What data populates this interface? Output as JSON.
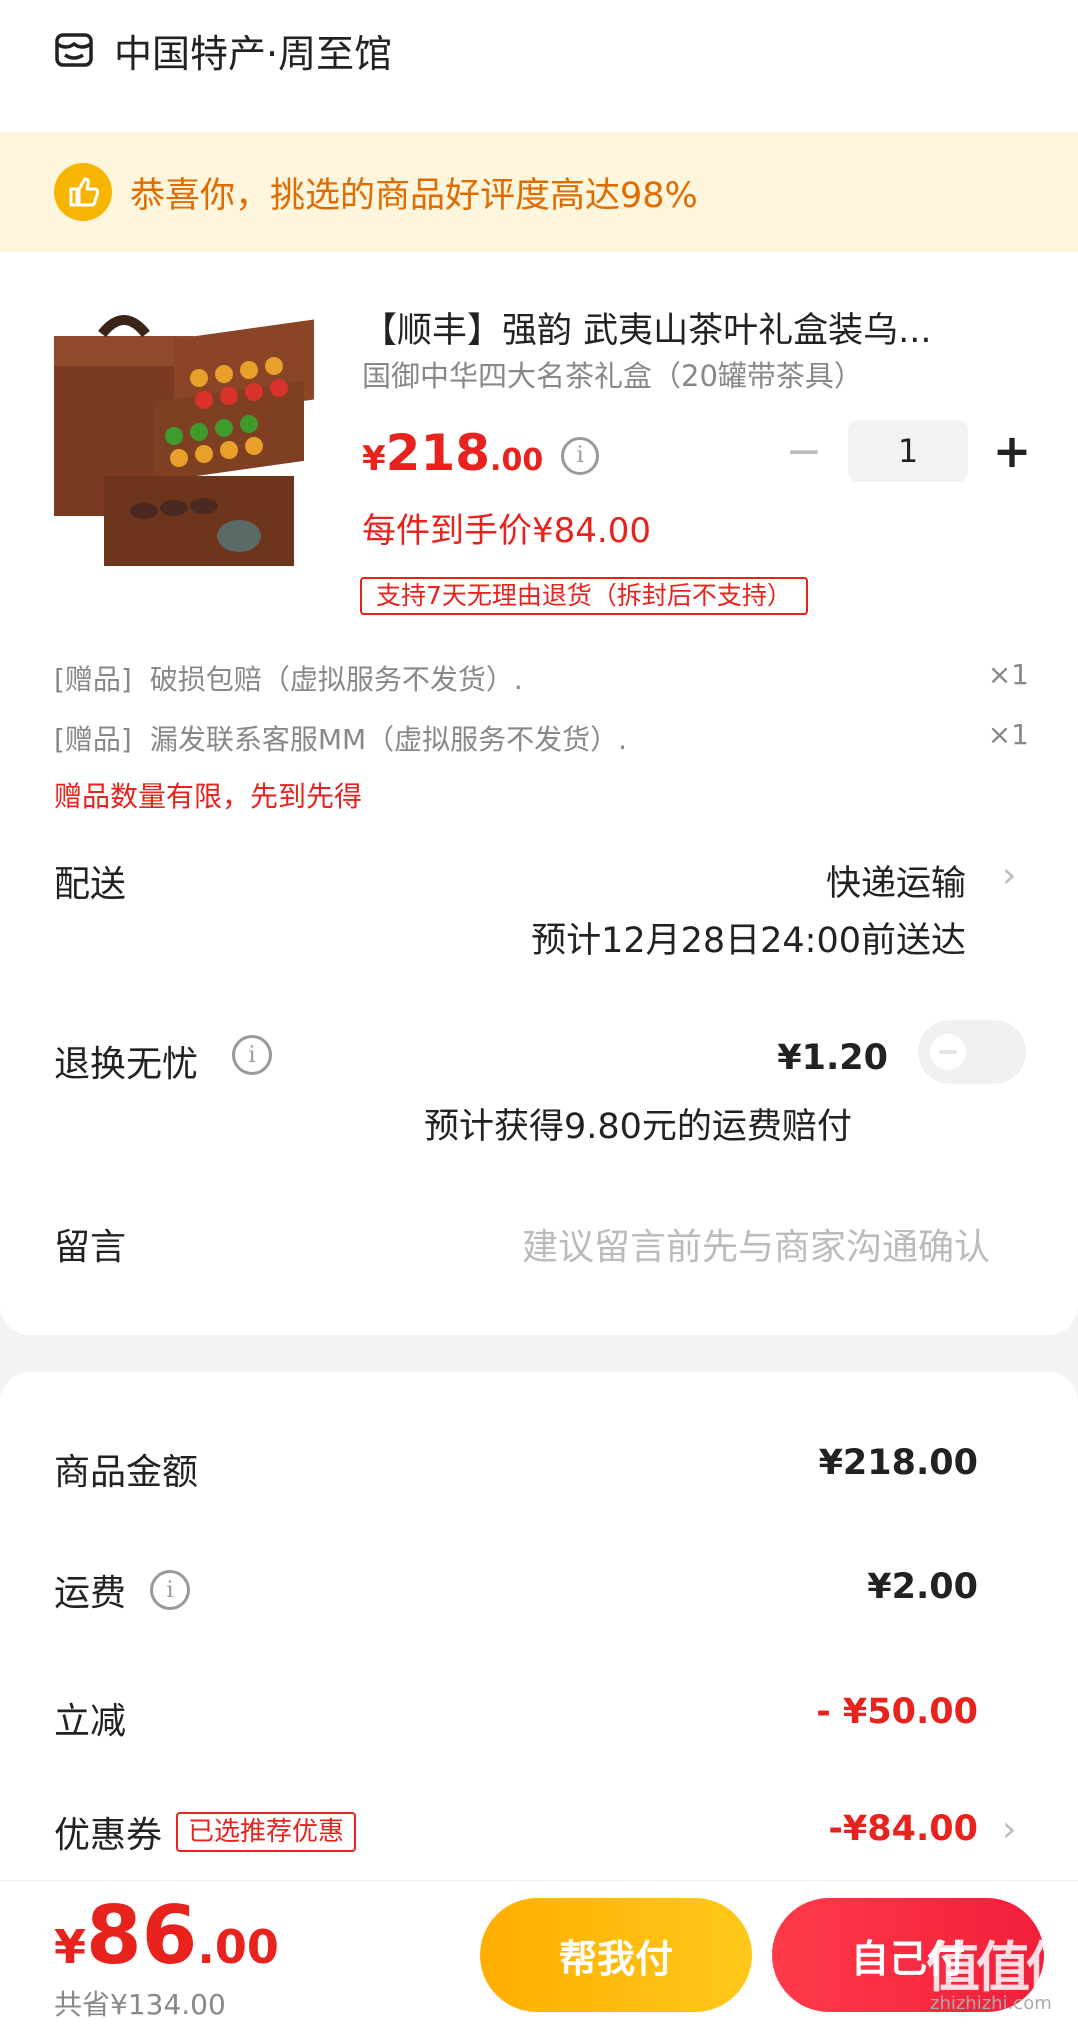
{
  "store": {
    "name": "中国特产·周至馆",
    "icon": "store-icon"
  },
  "banner": {
    "icon": "thumbs-up-icon",
    "text": "恭喜你，挑选的商品好评度高达98%"
  },
  "product": {
    "title": "【顺丰】强韵 武夷山茶叶礼盒装乌...",
    "subtitle": "国御中华四大名茶礼盒（20罐带茶具）",
    "price_symbol": "¥",
    "price_int": "218",
    "price_dec": ".00",
    "per_item_price": "每件到手价¥84.00",
    "return_policy": "支持7天无理由退货（拆封后不支持）",
    "quantity": "1",
    "minus_symbol": "−",
    "plus_symbol": "+",
    "info_symbol": "i"
  },
  "gifts": [
    {
      "tag": "[赠品]",
      "name": "破损包赔（虚拟服务不发货）.",
      "qty": "×1"
    },
    {
      "tag": "[赠品]",
      "name": "漏发联系客服MM（虚拟服务不发货）.",
      "qty": "×1"
    }
  ],
  "gift_note": "赠品数量有限，先到先得",
  "delivery": {
    "label": "配送",
    "method": "快递运输",
    "eta": "预计12月28日24:00前送达"
  },
  "return_insurance": {
    "label": "退换无忧",
    "price": "¥1.20",
    "note": "预计获得9.80元的运费赔付",
    "enabled": false
  },
  "message": {
    "label": "留言",
    "placeholder": "建议留言前先与商家沟通确认"
  },
  "summary": {
    "goods_label": "商品金额",
    "goods_value": "¥218.00",
    "shipping_label": "运费",
    "shipping_value": "¥2.00",
    "discount_label": "立减",
    "discount_value": "- ¥50.00",
    "coupon_label": "优惠券",
    "coupon_tag": "已选推荐优惠",
    "coupon_value": "-¥84.00"
  },
  "footer": {
    "total_symbol": "¥",
    "total_int": "86",
    "total_dec": ".00",
    "saved": "共省¥134.00",
    "help_pay": "帮我付",
    "self_pay": "自己付",
    "watermark": "值值值",
    "watermark_url": "zhizhizhi.com"
  },
  "colors": {
    "accent": "#e8221d",
    "banner_bg": "#fdf6dd",
    "banner_text": "#e06b00",
    "help_btn": "#ffb300",
    "self_btn": "#f5293f"
  }
}
